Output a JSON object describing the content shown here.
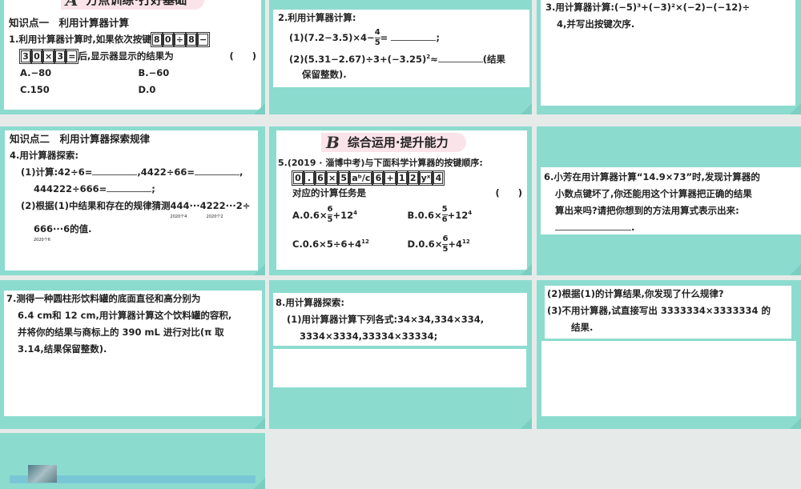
{
  "slides": {
    "s1": {
      "banner_letter": "A",
      "banner_text": "方点训练·打好基础",
      "knowledge_point": "知识点一　利用计算器计算",
      "q1_text": "1.利用计算器计算时,如果依次按键",
      "q1_keys_a": [
        "8",
        "0",
        "÷",
        "8",
        "−"
      ],
      "q1_keys_b": [
        "3",
        "0",
        "×",
        "3",
        "="
      ],
      "q1_text2": "后,显示器显示的结果为",
      "paren": "(　　)",
      "options": [
        "A.−80",
        "B.−60",
        "C.150",
        "D.0"
      ]
    },
    "s2": {
      "q2_title": "2.利用计算器计算:",
      "p1_pre": "(1)(7.2−3.5)×4−",
      "p1_num": "4",
      "p1_den": "5",
      "p1_post": "=",
      "p1_end": ";",
      "p2_pre": "(2)(5.31−2.67)÷3+(−3.25)",
      "p2_sup": "2",
      "p2_approx": "≈",
      "p2_note": "(结果",
      "p2_note2": "保留整数)."
    },
    "s3": {
      "line1": "3.用计算器计算:(−5)³+(−3)²×(−2)−(−12)÷",
      "line2": "4,并写出按键次序."
    },
    "s4": {
      "knowledge_point": "知识点二　利用计算器探索规律",
      "q4_title": "4.用计算器探索:",
      "p1_a": "(1)计算:42÷6=",
      "p1_b": ",4422÷66=",
      "p1_c": ",",
      "p1_d": "444222÷666=",
      "p1_e": ";",
      "p2_a": "(2)根据(1)中结果和存在的规律猜测",
      "brace1": "444···4",
      "brace1_label": "2020个4",
      "brace2": "222···2",
      "brace2_label": "2020个2",
      "div": "÷",
      "brace3": "666···6",
      "brace3_label": "2020个6",
      "p2_end": "的值."
    },
    "s5": {
      "banner_letter": "B",
      "banner_text": "综合运用·提升能力",
      "q5_text": "5.(2019 · 淄博中考)与下面科学计算器的按键顺序:",
      "keys": [
        "0",
        ".",
        "6",
        "×",
        "5",
        "aᵇ/c",
        "6",
        "+",
        "1",
        "2",
        "yˣ",
        "4"
      ],
      "task": "对应的计算任务是",
      "paren": "(　　)",
      "opt_a_pre": "A.0.6×",
      "opt_a_num": "6",
      "opt_a_den": "5",
      "opt_a_post": "+12",
      "opt_a_sup": "4",
      "opt_b_pre": "B.0.6×",
      "opt_b_num": "5",
      "opt_b_den": "6",
      "opt_b_post": "+12",
      "opt_b_sup": "4",
      "opt_c_pre": "C.0.6×5÷6+4",
      "opt_c_sup": "12",
      "opt_d_pre": "D.0.6×",
      "opt_d_num": "6",
      "opt_d_den": "5",
      "opt_d_post": "+4",
      "opt_d_sup": "12"
    },
    "s6": {
      "line1": "6.小芳在用计算器计算“14.9×73”时,发现计算器的",
      "line2": "小数点键坏了,你还能用这个计算器把正确的结果",
      "line3": "算出来吗?请把你想到的方法用算式表示出来:",
      "end": "."
    },
    "s7": {
      "line1": "7.测得一种圆柱形饮料罐的底面直径和高分别为",
      "line2": "6.4 cm和 12 cm,用计算器计算这个饮料罐的容积,",
      "line3": "并将你的结果与商标上的 390 mL 进行对比(π 取",
      "line4": "3.14,结果保留整数)."
    },
    "s8": {
      "line1": "8.用计算器探索:",
      "line2": "(1)用计算器计算下列各式:34×34,334×334,",
      "line3": "3334×3334,33334×33334;"
    },
    "s9": {
      "line1": "(2)根据(1)的计算结果,你发现了什么规律?",
      "line2": "(3)不用计算器,试直接写出 3333334×3333334 的",
      "line3": "结果."
    }
  },
  "colors": {
    "slide_bg": "#8cdbcf",
    "background": "#e6ebe9",
    "banner": "#fbe3ea"
  }
}
